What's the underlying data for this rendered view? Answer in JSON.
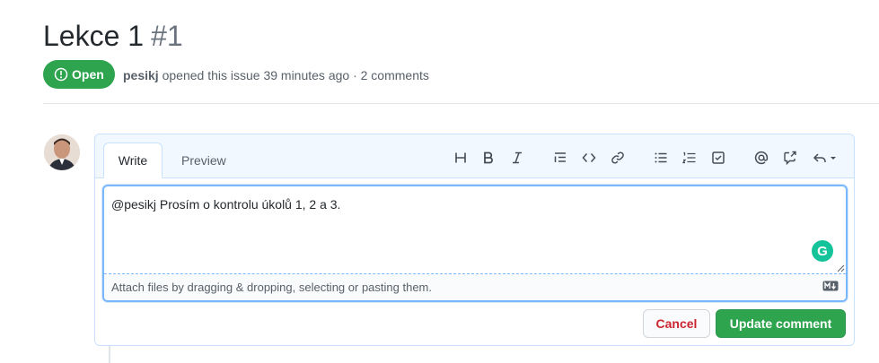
{
  "issue": {
    "title": "Lekce 1",
    "number": "#1",
    "state": "Open",
    "author": "pesikj",
    "meta_text": " opened this issue 39 minutes ago · 2 comments"
  },
  "editor": {
    "tabs": [
      {
        "label": "Write",
        "active": true
      },
      {
        "label": "Preview",
        "active": false
      }
    ],
    "toolbar": [
      "heading-icon",
      "bold-icon",
      "italic-icon",
      "quote-icon",
      "code-icon",
      "link-icon",
      "bullet-list-icon",
      "numbered-list-icon",
      "task-list-icon",
      "mention-icon",
      "cross-reference-icon",
      "saved-reply-icon"
    ],
    "content": "@pesikj Prosím o kontrolu úkolů 1, 2 a 3.",
    "attach_hint": "Attach files by dragging & dropping, selecting or pasting them.",
    "grammarly_letter": "G"
  },
  "actions": {
    "cancel_label": "Cancel",
    "update_label": "Update comment"
  },
  "colors": {
    "open_green": "#2ea44f",
    "cancel_red": "#cb2431",
    "focus_blue": "#79b8ff",
    "grammarly_green": "#15c39a"
  }
}
